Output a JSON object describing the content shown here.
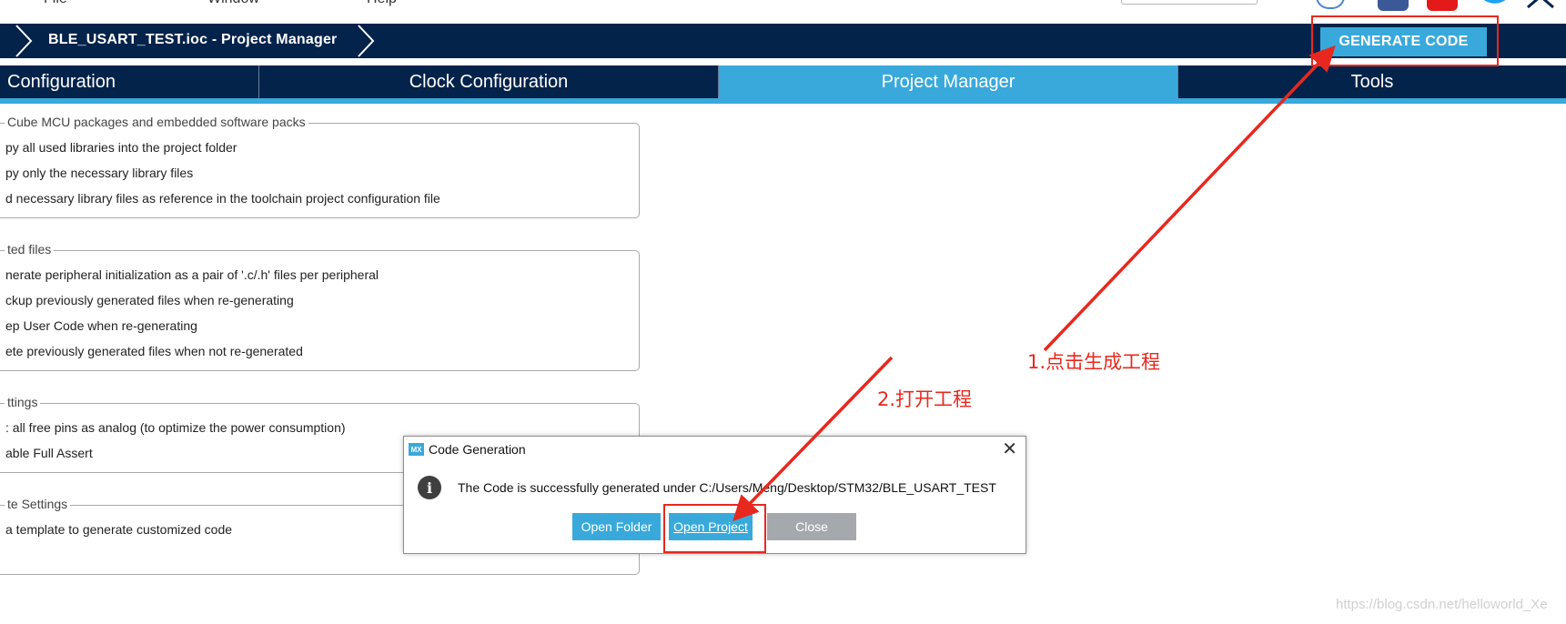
{
  "menubar": {
    "items": [
      "File",
      "Window",
      "Help"
    ]
  },
  "icons": [
    "globe-icon",
    "facebook-icon",
    "youtube-icon",
    "twitter-icon",
    "network-icon",
    "info-icon",
    "close-icon"
  ],
  "breadcrumb": {
    "title": "BLE_USART_TEST.ioc - Project Manager"
  },
  "toolbar": {
    "generate_label": "GENERATE CODE"
  },
  "tabs": [
    {
      "label": "Configuration",
      "active": false
    },
    {
      "label": "Clock Configuration",
      "active": false
    },
    {
      "label": "Project Manager",
      "active": true
    },
    {
      "label": "Tools",
      "active": false
    }
  ],
  "groups": {
    "packs": {
      "legend": "Cube MCU packages and embedded software packs",
      "options": [
        "py all used libraries into the project folder",
        "py only the necessary library files",
        "d necessary library files as reference in the toolchain project configuration file"
      ]
    },
    "generated": {
      "legend": "ted files",
      "options": [
        "nerate peripheral initialization as a pair of '.c/.h' files per peripheral",
        "ckup previously generated files when re-generating",
        "ep User Code when re-generating",
        "ete previously generated files when not re-generated"
      ]
    },
    "hal": {
      "legend": "ttings",
      "options": [
        ": all free pins as analog (to optimize the power consumption)",
        "able Full Assert"
      ]
    },
    "template": {
      "legend": "te Settings",
      "options": [
        "a template to generate customized code"
      ]
    }
  },
  "dialog": {
    "icon_label": "MX",
    "title": "Code Generation",
    "close_glyph": "✕",
    "info_glyph": "i",
    "message": "The Code is successfully generated under C:/Users/Meng/Desktop/STM32/BLE_USART_TEST",
    "buttons": {
      "open_folder": "Open Folder",
      "open_project": "Open Project",
      "close": "Close"
    }
  },
  "annotations": {
    "step1": "1.点击生成工程",
    "step2": "2.打开工程",
    "color": "#e8281e"
  },
  "watermark": "https://blog.csdn.net/helloworld_Xe",
  "colors": {
    "navy": "#03234b",
    "accent": "#39a9db",
    "gray_button": "#a5a9ad"
  }
}
